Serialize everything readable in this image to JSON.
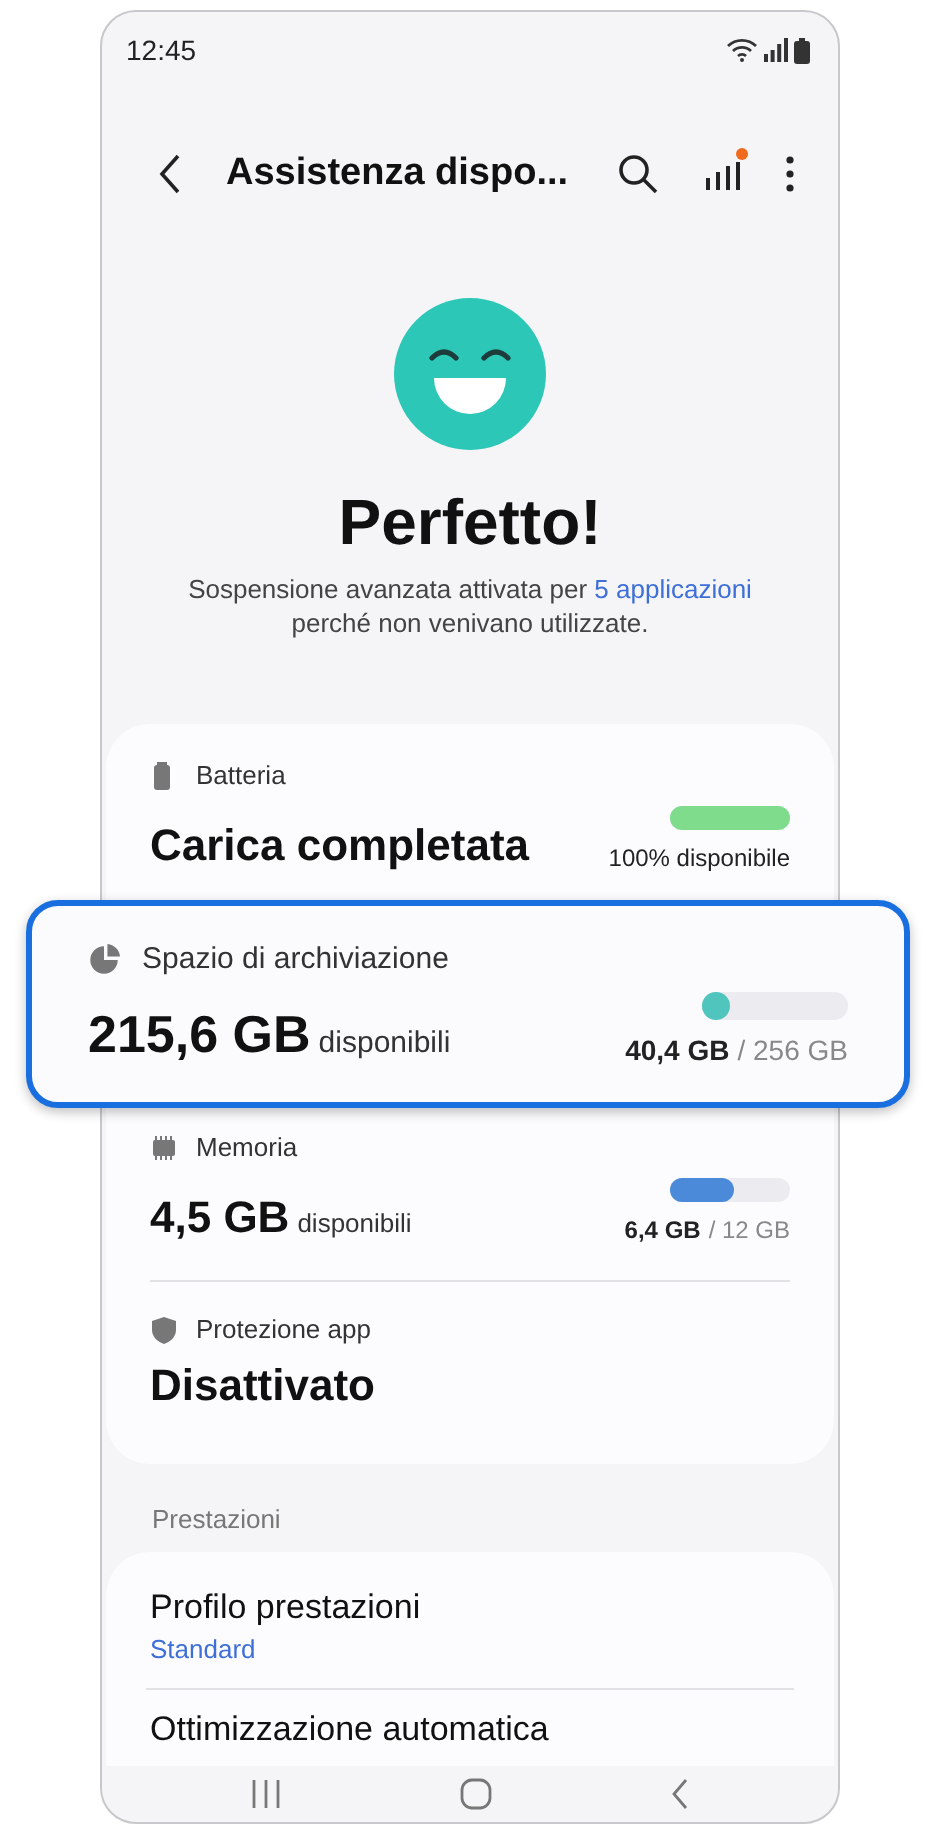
{
  "status_bar": {
    "time": "12:45"
  },
  "app_bar": {
    "title": "Assistenza dispo...",
    "diagnostics_badge": true
  },
  "hero": {
    "status": "Perfetto!",
    "message_before": "Sospensione avanzata attivata per",
    "message_link": "5 applicazioni",
    "message_after": "perché non venivano utilizzate."
  },
  "cards": [
    {
      "kind": "battery",
      "label": "Batteria",
      "value": "Carica completata",
      "highlighted": false,
      "level": 1,
      "color": "#7edc8c",
      "reading": "100% disponibile"
    },
    {
      "kind": "storage",
      "label": "Spazio di archiviazione",
      "value": "215,6 GB",
      "unit": "disponibili",
      "highlighted": true,
      "level": 0.16,
      "color": "#4fc5be",
      "used": "40,4 GB",
      "total": "/ 256 GB"
    },
    {
      "kind": "memory",
      "label": "Memoria",
      "value": "4,5 GB",
      "unit": "disponibili",
      "highlighted": false,
      "level": 0.53,
      "color": "#4a8ad8",
      "used": "6,4 GB",
      "total": "/ 12 GB"
    },
    {
      "kind": "protection",
      "label": "Protezione app",
      "value": "Disattivato",
      "highlighted": false
    }
  ],
  "performance": {
    "heading": "Prestazioni",
    "items": [
      {
        "title": "Profilo prestazioni",
        "subtitle": "Standard"
      },
      {
        "title": "Ottimizzazione automatica"
      }
    ]
  }
}
